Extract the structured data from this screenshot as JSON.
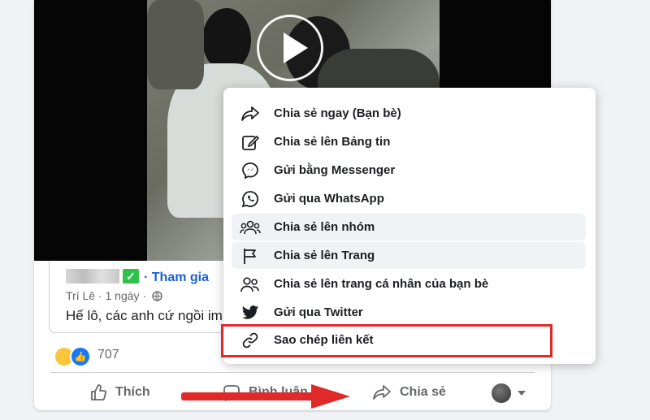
{
  "post": {
    "profile_verified": "✓",
    "join_link": "· Tham gia",
    "meta": "Trí Lê · 1 ngày ·",
    "text": "Hế lô, các anh cứ ngồi im"
  },
  "reactions": {
    "count": "707"
  },
  "actions": {
    "like": "Thích",
    "comment": "Bình luận",
    "share": "Chia sẻ"
  },
  "share_menu": {
    "items": [
      {
        "label": "Chia sẻ ngay (Bạn bè)",
        "icon": "share-arrow-icon"
      },
      {
        "label": "Chia sẻ lên Bảng tin",
        "icon": "edit-icon"
      },
      {
        "label": "Gửi bằng Messenger",
        "icon": "messenger-icon"
      },
      {
        "label": "Gửi qua WhatsApp",
        "icon": "whatsapp-icon"
      },
      {
        "label": "Chia sẻ lên nhóm",
        "icon": "group-icon"
      },
      {
        "label": "Chia sẻ lên Trang",
        "icon": "flag-icon"
      },
      {
        "label": "Chia sẻ lên trang cá nhân của bạn bè",
        "icon": "friends-icon"
      },
      {
        "label": "Gửi qua Twitter",
        "icon": "twitter-icon"
      },
      {
        "label": "Sao chép liên kết",
        "icon": "link-icon"
      }
    ]
  },
  "colors": {
    "accent": "#1877f2",
    "highlight_box": "#e02a2a",
    "arrow": "#e02a2a",
    "verified": "#2ec24b"
  }
}
